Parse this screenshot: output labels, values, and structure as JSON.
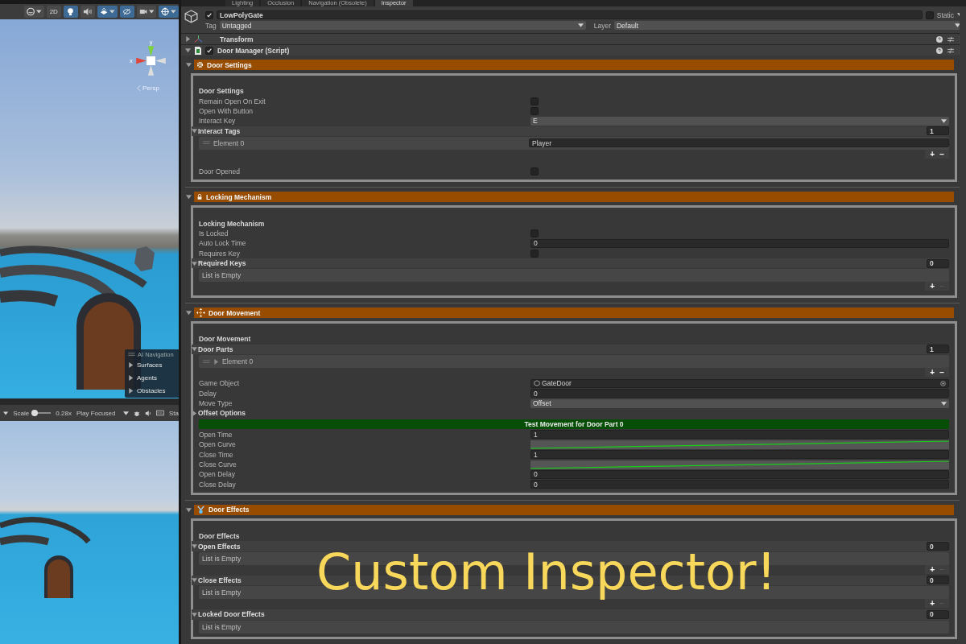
{
  "scene_toolbar": [
    {
      "kind": "shading",
      "on": false
    },
    {
      "kind": "label",
      "label": "2D",
      "on": false
    },
    {
      "kind": "lighting",
      "on": true
    },
    {
      "kind": "audio",
      "on": false
    },
    {
      "kind": "effects",
      "on": true
    },
    {
      "kind": "visibility",
      "on": true
    },
    {
      "kind": "camera",
      "on": false
    },
    {
      "kind": "gizmos",
      "on": true
    }
  ],
  "scene_view": {
    "axis_labels": [
      "y",
      "x"
    ],
    "projection": "Persp"
  },
  "ai_navigation": {
    "title": "AI Navigation",
    "items": [
      "Surfaces",
      "Agents",
      "Obstacles"
    ]
  },
  "game_toolbar": {
    "scale": {
      "label": "Scale",
      "level": 0.05,
      "value": "0.28x"
    },
    "play_mode": "Play Focused",
    "stats_label": "Sta"
  },
  "tabs": [
    {
      "label": "Lighting",
      "selected": false
    },
    {
      "label": "Occlusion",
      "selected": false
    },
    {
      "label": "Navigation (Obsolete)",
      "selected": false
    },
    {
      "label": "Inspector",
      "selected": true
    }
  ],
  "object": {
    "active": true,
    "name": "LowPolyGate",
    "static": false,
    "static_label": "Static",
    "tag_label": "Tag",
    "tag": "Untagged",
    "layer_label": "Layer",
    "layer": "Default"
  },
  "components": [
    {
      "name": "Transform",
      "kind": "transform",
      "expanded": false
    },
    {
      "name": "Door Manager (Script)",
      "kind": "script",
      "expanded": true,
      "enabled": true
    }
  ],
  "sections": [
    {
      "title": "Door Settings",
      "expanded": true,
      "rows": [
        {
          "kind": "heading",
          "label": "Door Settings"
        },
        {
          "kind": "checkbox",
          "label": "Remain Open On Exit",
          "checked": false
        },
        {
          "kind": "checkbox",
          "label": "Open With Button",
          "checked": false
        },
        {
          "kind": "dropdown",
          "label": "Interact Key",
          "value": "E"
        },
        {
          "kind": "list",
          "label": "Interact Tags",
          "expanded": true,
          "count": "1",
          "elements": [
            {
              "kind": "value",
              "label": "Element 0",
              "value": "Player"
            }
          ],
          "add": "+",
          "remove": "−",
          "remove_disabled": false
        },
        {
          "kind": "checkbox",
          "label": "Door Opened",
          "checked": false
        }
      ]
    },
    {
      "title": "Locking Mechanism",
      "expanded": true,
      "rows": [
        {
          "kind": "heading",
          "label": "Locking Mechanism"
        },
        {
          "kind": "checkbox",
          "label": "Is Locked",
          "checked": false
        },
        {
          "kind": "number",
          "label": "Auto Lock Time",
          "value": "0"
        },
        {
          "kind": "checkbox",
          "label": "Requires Key",
          "checked": false
        },
        {
          "kind": "list",
          "label": "Required Keys",
          "expanded": true,
          "count": "0",
          "empty_text": "List is Empty",
          "add": "+",
          "remove": "−",
          "remove_disabled": true
        }
      ]
    },
    {
      "title": "Door Movement",
      "expanded": true,
      "rows": [
        {
          "kind": "heading",
          "label": "Door Movement"
        },
        {
          "kind": "list",
          "label": "Door Parts",
          "expanded": true,
          "count": "1",
          "elements": [
            {
              "kind": "foldout",
              "label": "Element 0",
              "expanded": false
            }
          ],
          "add": "+",
          "remove": "−",
          "remove_disabled": false
        },
        {
          "kind": "object",
          "label": "Game Object",
          "value": "GateDoor"
        },
        {
          "kind": "number",
          "label": "Delay",
          "value": "0"
        },
        {
          "kind": "dropdown",
          "label": "Move Type",
          "value": "Offset"
        },
        {
          "kind": "foldout",
          "label": "Offset Options",
          "expanded": false
        },
        {
          "kind": "button",
          "label": "Test Movement for Door Part 0"
        },
        {
          "kind": "number",
          "label": "Open Time",
          "value": "1"
        },
        {
          "kind": "curve",
          "label": "Open Curve"
        },
        {
          "kind": "number",
          "label": "Close Time",
          "value": "1"
        },
        {
          "kind": "curve",
          "label": "Close Curve"
        },
        {
          "kind": "number",
          "label": "Open Delay",
          "value": "0"
        },
        {
          "kind": "number",
          "label": "Close Delay",
          "value": "0"
        }
      ]
    },
    {
      "title": "Door Effects",
      "expanded": true,
      "rows": [
        {
          "kind": "heading",
          "label": "Door Effects"
        },
        {
          "kind": "list",
          "label": "Open Effects",
          "expanded": true,
          "count": "0",
          "empty_text": "List is Empty",
          "add": "+",
          "remove": "−",
          "remove_disabled": true
        },
        {
          "kind": "list",
          "label": "Close Effects",
          "expanded": true,
          "count": "0",
          "empty_text": "List is Empty",
          "add": "+",
          "remove": "−",
          "remove_disabled": true
        },
        {
          "kind": "list",
          "label": "Locked Door Effects",
          "expanded": true,
          "count": "0",
          "empty_text": "List is Empty"
        }
      ]
    }
  ],
  "caption": "Custom Inspector!"
}
